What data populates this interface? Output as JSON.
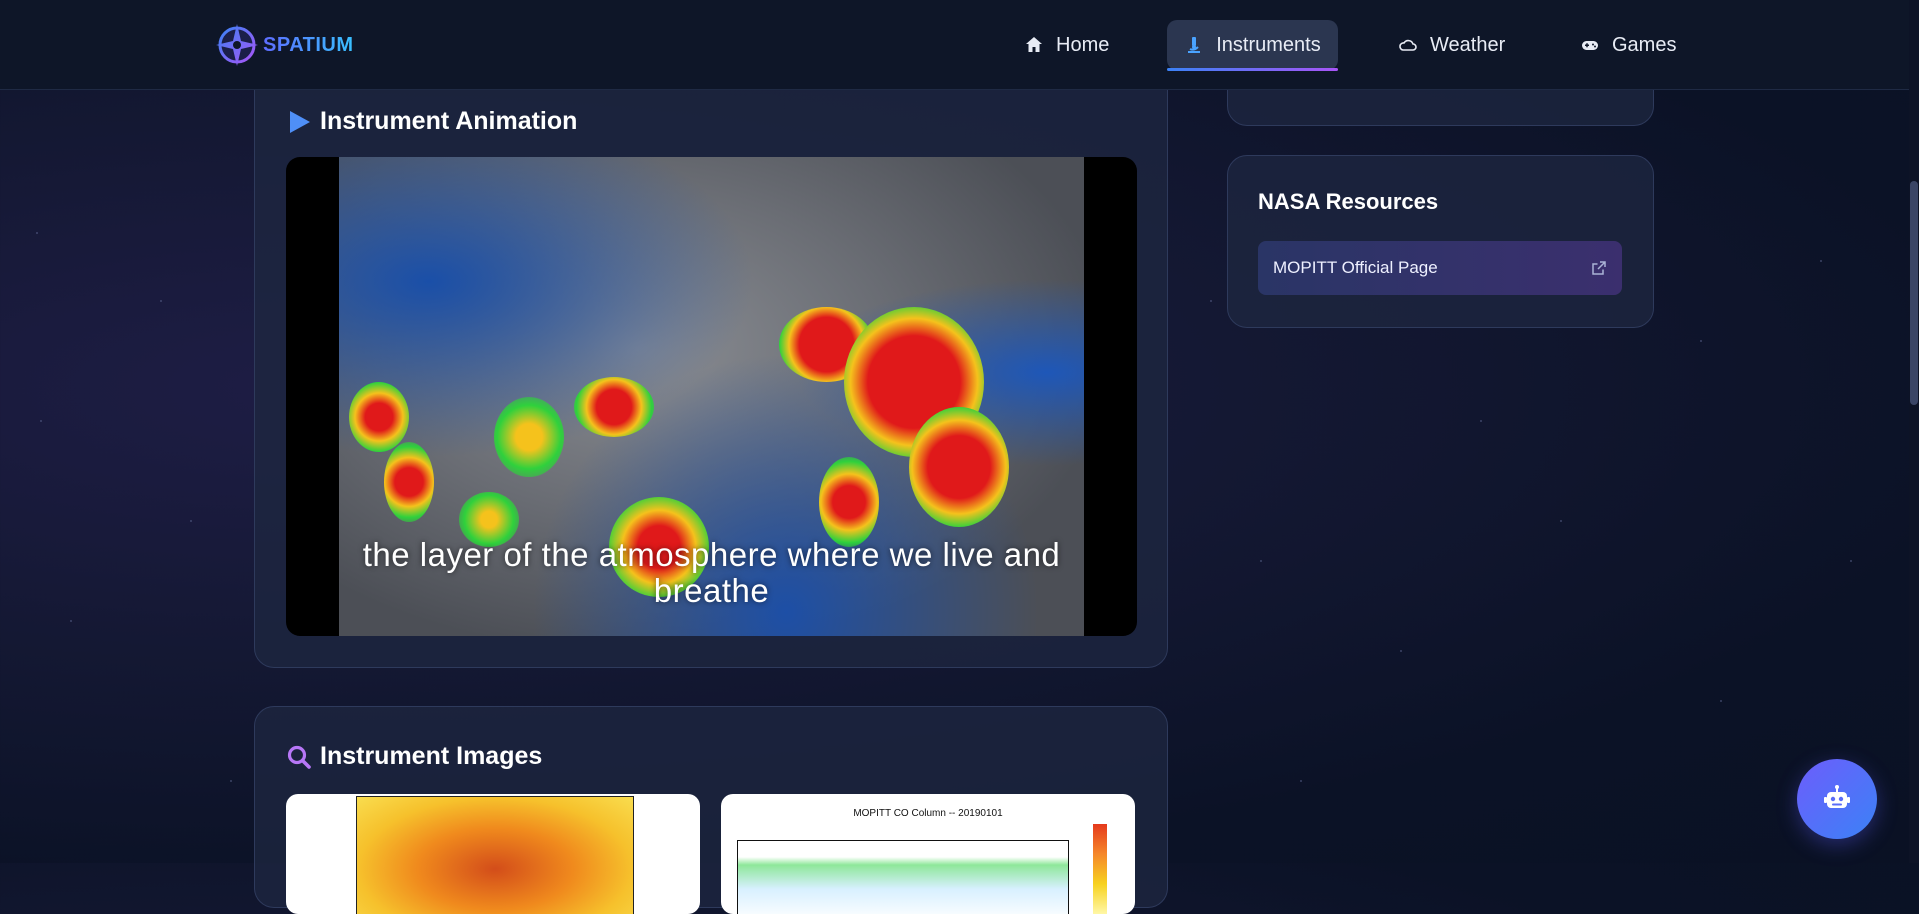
{
  "brand": {
    "name": "SPATIUM"
  },
  "nav": {
    "items": [
      {
        "label": "Home",
        "icon": "home-icon"
      },
      {
        "label": "Instruments",
        "icon": "microscope-icon",
        "active": true
      },
      {
        "label": "Weather",
        "icon": "cloud-icon"
      },
      {
        "label": "Games",
        "icon": "gamepad-icon"
      }
    ]
  },
  "animation": {
    "title": "Instrument Animation",
    "icon": "play-icon",
    "caption": "the layer of the atmosphere where we live and breathe"
  },
  "images": {
    "title": "Instrument Images",
    "icon": "search-icon",
    "thumb2_title": "MOPITT CO Column -- 20190101"
  },
  "resources": {
    "title": "NASA Resources",
    "link_label": "MOPITT Official Page",
    "link_icon": "external-link-icon"
  },
  "chatbot": {
    "icon": "robot-icon"
  },
  "colors": {
    "accent_blue": "#3b82f6",
    "accent_purple": "#a855f7",
    "background": "#0b1226"
  }
}
